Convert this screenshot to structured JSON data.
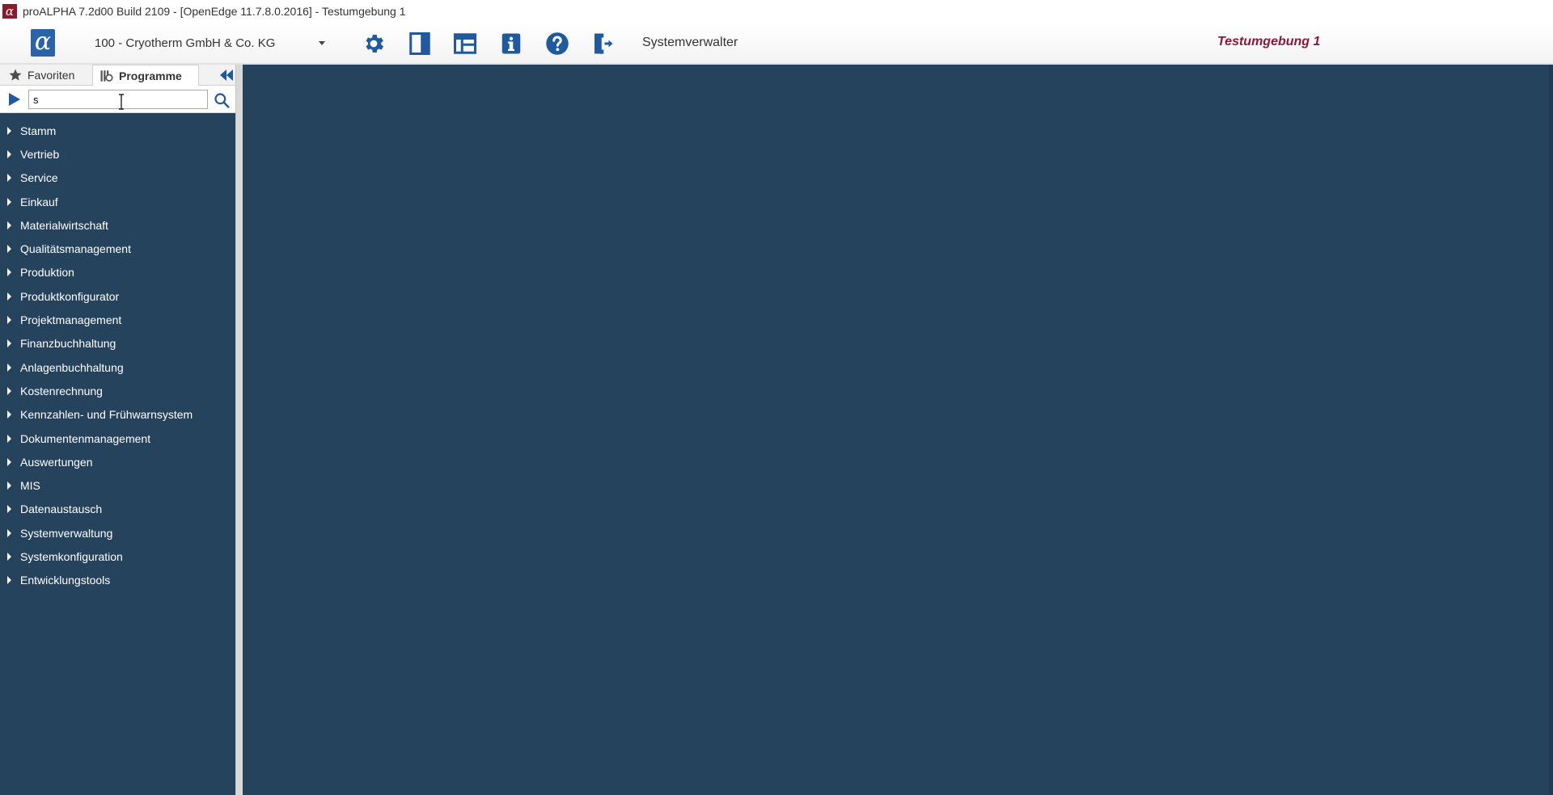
{
  "window": {
    "title": "proALPHA 7.2d00 Build 2109 - [OpenEdge 11.7.8.0.2016] - Testumgebung 1"
  },
  "toolbar": {
    "company": "100 - Cryotherm GmbH & Co. KG",
    "user": "Systemverwalter",
    "environment": "Testumgebung 1",
    "icons": [
      "gear-icon",
      "panel-icon",
      "layout-icon",
      "info-icon",
      "help-icon",
      "logout-icon"
    ]
  },
  "sidebar": {
    "tabs": [
      {
        "label": "Favoriten",
        "icon": "star-icon"
      },
      {
        "label": "Programme",
        "icon": "programs-icon",
        "active": true
      }
    ],
    "search": {
      "value": "s"
    },
    "items": [
      {
        "label": "Stamm"
      },
      {
        "label": "Vertrieb"
      },
      {
        "label": "Service"
      },
      {
        "label": "Einkauf"
      },
      {
        "label": "Materialwirtschaft"
      },
      {
        "label": "Qualitätsmanagement"
      },
      {
        "label": "Produktion"
      },
      {
        "label": "Produktkonfigurator"
      },
      {
        "label": "Projektmanagement"
      },
      {
        "label": "Finanzbuchhaltung"
      },
      {
        "label": "Anlagenbuchhaltung"
      },
      {
        "label": "Kostenrechnung"
      },
      {
        "label": "Kennzahlen- und Frühwarnsystem"
      },
      {
        "label": "Dokumentenmanagement"
      },
      {
        "label": "Auswertungen"
      },
      {
        "label": "MIS"
      },
      {
        "label": "Datenaustausch"
      },
      {
        "label": "Systemverwaltung"
      },
      {
        "label": "Systemkonfiguration"
      },
      {
        "label": "Entwicklungstools"
      }
    ]
  },
  "colors": {
    "accent": "#1f5aa0",
    "panel_bg": "#26435e",
    "environment": "#8b1a3a"
  }
}
